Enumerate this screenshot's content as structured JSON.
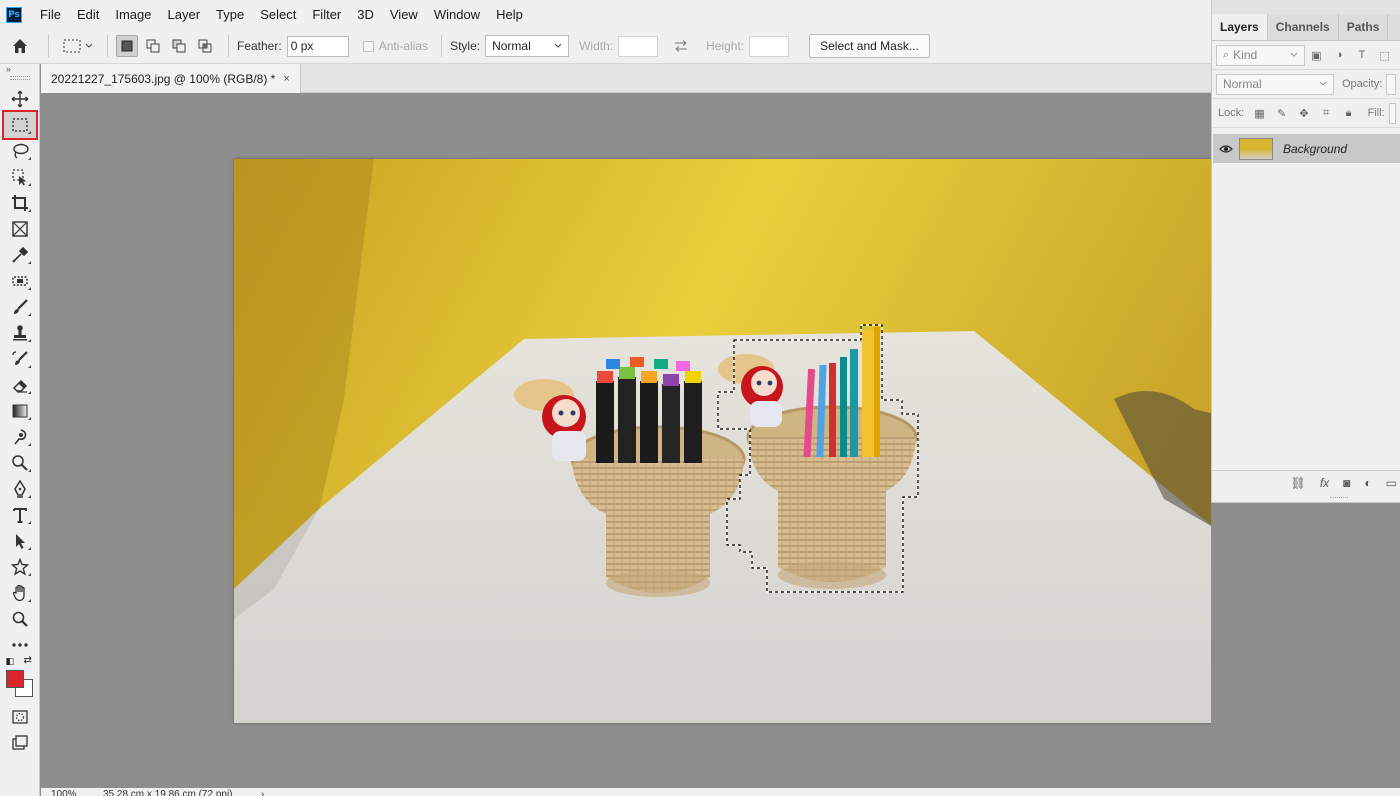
{
  "app": {
    "logo": "Ps"
  },
  "menu": [
    "File",
    "Edit",
    "Image",
    "Layer",
    "Type",
    "Select",
    "Filter",
    "3D",
    "View",
    "Window",
    "Help"
  ],
  "options": {
    "feather_label": "Feather:",
    "feather_value": "0 px",
    "antialias_label": "Anti-alias",
    "style_label": "Style:",
    "style_value": "Normal",
    "width_label": "Width:",
    "height_label": "Height:",
    "select_mask_label": "Select and Mask..."
  },
  "document": {
    "tab_title": "20221227_175603.jpg @ 100% (RGB/8) *",
    "close_glyph": "×"
  },
  "toolbar": {
    "collapse_glyph": "»",
    "tools": [
      "move",
      "rectangular-marquee",
      "lasso",
      "object-selection",
      "crop",
      "frame",
      "eyedropper",
      "spot-healing",
      "brush",
      "clone-stamp",
      "history-brush",
      "eraser",
      "gradient",
      "blur",
      "dodge",
      "pen",
      "type",
      "path-selection",
      "shape",
      "hand",
      "zoom",
      "more"
    ],
    "selected_tool": "rectangular-marquee",
    "foreground_color": "#d9262c",
    "background_color": "#ffffff"
  },
  "status": {
    "zoom": "100%",
    "doc_size": "35.28 cm x 19.86 cm (72 ppi)",
    "arrow": "›"
  },
  "layers_panel": {
    "tabs": [
      "Layers",
      "Channels",
      "Paths"
    ],
    "active_tab": "Layers",
    "kind_label": "Kind",
    "blend_mode": "Normal",
    "opacity_label": "Opacity:",
    "lock_label": "Lock:",
    "fill_label": "Fill:",
    "layers": [
      {
        "name": "Background",
        "visible": true
      }
    ]
  },
  "colors": {
    "accent_selection": "#d9262c",
    "wall_yellow": "#d8b330"
  }
}
